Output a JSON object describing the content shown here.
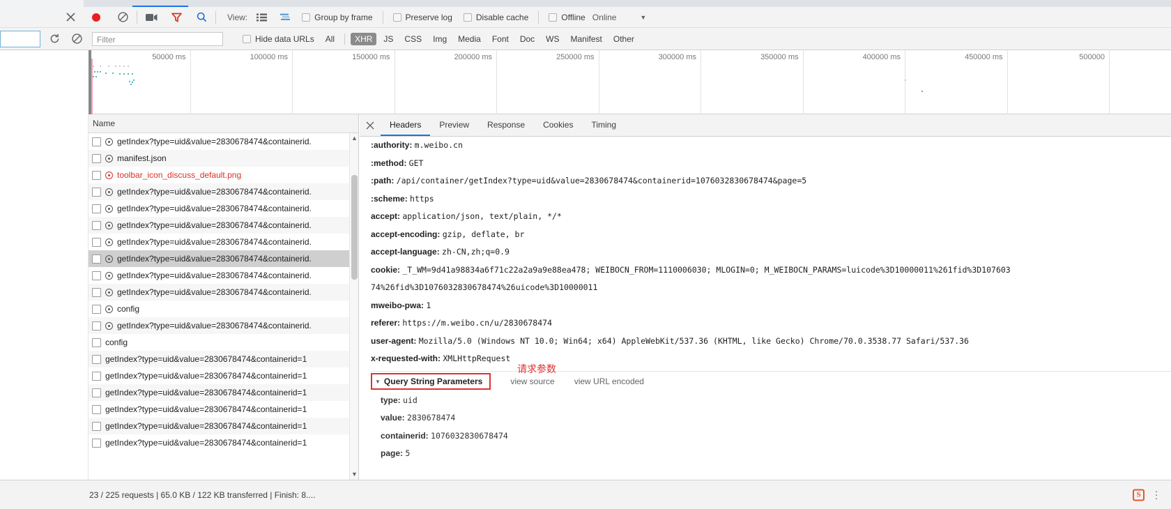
{
  "toolbar": {
    "close_label": "✕",
    "record_icon": "record-icon",
    "clear_icon": "clear-icon",
    "camera_icon": "camera-icon",
    "filter_icon": "filter-icon",
    "search_icon": "search-icon",
    "view_label": "View:",
    "view_list_icon": "list-view-icon",
    "view_waterfall_icon": "waterfall-view-icon",
    "group_by_frame": "Group by frame",
    "preserve_log": "Preserve log",
    "disable_cache": "Disable cache",
    "offline": "Offline",
    "online": "Online",
    "throttle_caret": "▼"
  },
  "filterbar": {
    "reload_icon": "reload-icon",
    "block_icon": "block-icon",
    "filter_placeholder": "Filter",
    "filter_value": "",
    "hide_data_urls": "Hide data URLs",
    "types": [
      "All",
      "XHR",
      "JS",
      "CSS",
      "Img",
      "Media",
      "Font",
      "Doc",
      "WS",
      "Manifest",
      "Other"
    ],
    "active_type": "XHR"
  },
  "overview": {
    "ticks": [
      "50000 ms",
      "100000 ms",
      "150000 ms",
      "200000 ms",
      "250000 ms",
      "300000 ms",
      "350000 ms",
      "400000 ms",
      "450000 ms",
      "500000"
    ]
  },
  "requests": {
    "column_header": "Name",
    "rows": [
      {
        "name": "getIndex?type=uid&value=2830678474&containerid.",
        "icon": true,
        "error": false,
        "selected": false
      },
      {
        "name": "manifest.json",
        "icon": true,
        "error": false,
        "selected": false
      },
      {
        "name": "toolbar_icon_discuss_default.png",
        "icon": true,
        "error": true,
        "selected": false
      },
      {
        "name": "getIndex?type=uid&value=2830678474&containerid.",
        "icon": true,
        "error": false,
        "selected": false
      },
      {
        "name": "getIndex?type=uid&value=2830678474&containerid.",
        "icon": true,
        "error": false,
        "selected": false
      },
      {
        "name": "getIndex?type=uid&value=2830678474&containerid.",
        "icon": true,
        "error": false,
        "selected": false
      },
      {
        "name": "getIndex?type=uid&value=2830678474&containerid.",
        "icon": true,
        "error": false,
        "selected": false
      },
      {
        "name": "getIndex?type=uid&value=2830678474&containerid.",
        "icon": true,
        "error": false,
        "selected": true
      },
      {
        "name": "getIndex?type=uid&value=2830678474&containerid.",
        "icon": true,
        "error": false,
        "selected": false
      },
      {
        "name": "getIndex?type=uid&value=2830678474&containerid.",
        "icon": true,
        "error": false,
        "selected": false
      },
      {
        "name": "config",
        "icon": true,
        "error": false,
        "selected": false
      },
      {
        "name": "getIndex?type=uid&value=2830678474&containerid.",
        "icon": true,
        "error": false,
        "selected": false
      },
      {
        "name": "config",
        "icon": false,
        "error": false,
        "selected": false
      },
      {
        "name": "getIndex?type=uid&value=2830678474&containerid=1",
        "icon": false,
        "error": false,
        "selected": false
      },
      {
        "name": "getIndex?type=uid&value=2830678474&containerid=1",
        "icon": false,
        "error": false,
        "selected": false
      },
      {
        "name": "getIndex?type=uid&value=2830678474&containerid=1",
        "icon": false,
        "error": false,
        "selected": false
      },
      {
        "name": "getIndex?type=uid&value=2830678474&containerid=1",
        "icon": false,
        "error": false,
        "selected": false
      },
      {
        "name": "getIndex?type=uid&value=2830678474&containerid=1",
        "icon": false,
        "error": false,
        "selected": false
      },
      {
        "name": "getIndex?type=uid&value=2830678474&containerid=1",
        "icon": false,
        "error": false,
        "selected": false
      }
    ]
  },
  "status": {
    "summary": "23 / 225 requests  |  65.0 KB / 122 KB transferred  |  Finish: 8....",
    "badge": "S",
    "menu_icon": "vertical-dots-icon"
  },
  "details": {
    "tabs": [
      "Headers",
      "Preview",
      "Response",
      "Cookies",
      "Timing"
    ],
    "active_tab": "Headers",
    "close_label": "✕",
    "headers": [
      {
        "key": ":authority:",
        "value": "m.weibo.cn"
      },
      {
        "key": ":method:",
        "value": "GET"
      },
      {
        "key": ":path:",
        "value": "/api/container/getIndex?type=uid&value=2830678474&containerid=1076032830678474&page=5"
      },
      {
        "key": ":scheme:",
        "value": "https"
      },
      {
        "key": "accept:",
        "value": "application/json, text/plain, */*"
      },
      {
        "key": "accept-encoding:",
        "value": "gzip, deflate, br"
      },
      {
        "key": "accept-language:",
        "value": "zh-CN,zh;q=0.9"
      },
      {
        "key": "cookie:",
        "value": "_T_WM=9d41a98834a6f71c22a2a9a9e88ea478; WEIBOCN_FROM=1110006030; MLOGIN=0; M_WEIBOCN_PARAMS=luicode%3D10000011%261fid%3D107603"
      },
      {
        "key": "",
        "value": "74%26fid%3D1076032830678474%26uicode%3D10000011"
      },
      {
        "key": "mweibo-pwa:",
        "value": "1"
      },
      {
        "key": "referer:",
        "value": "https://m.weibo.cn/u/2830678474"
      },
      {
        "key": "user-agent:",
        "value": "Mozilla/5.0 (Windows NT 10.0; Win64; x64) AppleWebKit/537.36 (KHTML, like Gecko) Chrome/70.0.3538.77 Safari/537.36"
      },
      {
        "key": "x-requested-with:",
        "value": "XMLHttpRequest"
      }
    ],
    "qsp": {
      "title": "Query String Parameters",
      "caret": "▼",
      "view_source": "view source",
      "view_url_encoded": "view URL encoded",
      "annotation": "请求参数",
      "params": [
        {
          "key": "type:",
          "value": "uid"
        },
        {
          "key": "value:",
          "value": "2830678474"
        },
        {
          "key": "containerid:",
          "value": "1076032830678474"
        },
        {
          "key": "page:",
          "value": "5"
        }
      ]
    }
  },
  "colors": {
    "accent": "#1a73e8",
    "record": "#e8201f",
    "error": "#d93025",
    "annotation": "#e03131",
    "timeline_dot": "#14a5a5"
  }
}
